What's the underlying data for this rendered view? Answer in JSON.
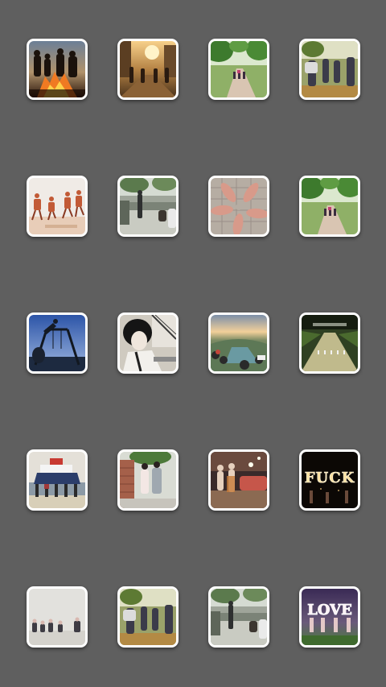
{
  "screen": {
    "background": "#5f5f5f",
    "tile_border": "#ffffff"
  },
  "photos": [
    {
      "name": "photo-bonfire-silhouettes",
      "icon": "bonfire-photo"
    },
    {
      "name": "photo-street-sunset-walk",
      "icon": "street-sunset-photo"
    },
    {
      "name": "photo-park-path-walk",
      "icon": "park-path-photo"
    },
    {
      "name": "photo-friends-walking-field",
      "icon": "friends-field-photo"
    },
    {
      "name": "photo-jumping-beach",
      "icon": "jumping-beach-photo"
    },
    {
      "name": "photo-bridge-river",
      "icon": "bridge-river-photo"
    },
    {
      "name": "photo-feet-circle",
      "icon": "feet-circle-photo"
    },
    {
      "name": "photo-park-path-walk-2",
      "icon": "park-path-photo"
    },
    {
      "name": "photo-swing-blue-sky",
      "icon": "swing-photo"
    },
    {
      "name": "photo-boy-portrait",
      "icon": "portrait-photo"
    },
    {
      "name": "photo-hilltop-sunset",
      "icon": "hilltop-photo"
    },
    {
      "name": "photo-tree-avenue",
      "icon": "tree-avenue-photo"
    },
    {
      "name": "photo-ship-harbor",
      "icon": "ship-harbor-photo"
    },
    {
      "name": "photo-brick-wall-couple",
      "icon": "brick-wall-photo"
    },
    {
      "name": "photo-car-party",
      "icon": "car-party-photo"
    },
    {
      "name": "photo-sparkler-letters",
      "icon": "sparkler-letters-photo",
      "text": "FUCK"
    },
    {
      "name": "photo-sitting-fog",
      "icon": "fog-group-photo"
    },
    {
      "name": "photo-friends-walking-field-2",
      "icon": "friends-field-photo"
    },
    {
      "name": "photo-bridge-river-2",
      "icon": "bridge-river-photo"
    },
    {
      "name": "photo-sparkler-love",
      "icon": "sparkler-love-photo",
      "text": "LOVE"
    }
  ]
}
